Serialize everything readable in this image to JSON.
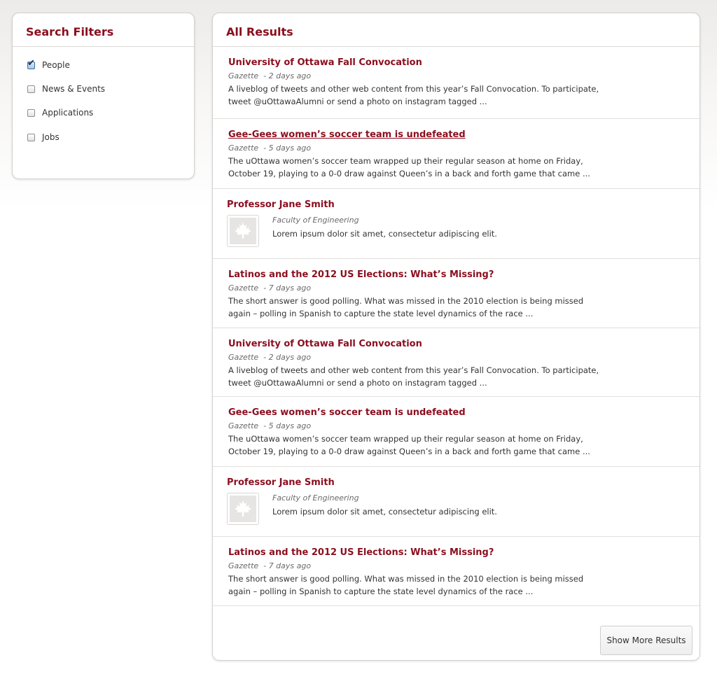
{
  "filters": {
    "title": "Search Filters",
    "items": [
      {
        "label": "People",
        "checked": true
      },
      {
        "label": "News & Events",
        "checked": false
      },
      {
        "label": "Applications",
        "checked": false
      },
      {
        "label": "Jobs",
        "checked": false
      }
    ]
  },
  "results": {
    "title": "All Results",
    "items": [
      {
        "type": "article",
        "title": "University of Ottawa Fall Convocation",
        "source": "Gazette",
        "date": "- 2 days ago",
        "excerpt": "A liveblog of tweets and other web content from this year’s Fall Convocation. To participate, tweet @uOttawaAlumni or send a photo on instagram tagged ..."
      },
      {
        "type": "article",
        "title": "Gee-Gees women’s soccer team is undefeated",
        "source": "Gazette",
        "date": "- 5 days ago",
        "excerpt": "The uOttawa women’s soccer team wrapped up their regular season at home on Friday, October 19, playing to a 0-0 draw against Queen’s in a back and forth game that came ..."
      },
      {
        "type": "person",
        "title": "Professor Jane Smith",
        "department": "Faculty of Engineering",
        "excerpt": "Lorem ipsum dolor sit amet, consectetur adipiscing elit."
      },
      {
        "type": "article",
        "title": "Latinos and the 2012 US Elections: What’s Missing?",
        "source": "Gazette",
        "date": "- 7 days ago",
        "excerpt": "The short answer is good polling. What was missed in the 2010 election is being missed again – polling in Spanish to capture the state level dynamics of the race ..."
      },
      {
        "type": "article",
        "title": "University of Ottawa Fall Convocation",
        "source": "Gazette",
        "date": "- 2 days ago",
        "excerpt": "A liveblog of tweets and other web content from this year’s Fall Convocation. To participate, tweet @uOttawaAlumni or send a photo on instagram tagged ..."
      },
      {
        "type": "article",
        "title": "Gee-Gees women’s soccer team is undefeated",
        "source": "Gazette",
        "date": "- 5 days ago",
        "excerpt": "The uOttawa women’s soccer team wrapped up their regular season at home on Friday, October 19, playing to a 0-0 draw against Queen’s in a back and forth game that came ..."
      },
      {
        "type": "person",
        "title": "Professor Jane Smith",
        "department": "Faculty of Engineering",
        "excerpt": "Lorem ipsum dolor sit amet, consectetur adipiscing elit."
      },
      {
        "type": "article",
        "title": "Latinos and the 2012 US Elections: What’s Missing?",
        "source": "Gazette",
        "date": "- 7 days ago",
        "excerpt": "The short answer is good polling. What was missed in the 2010 election is being missed again – polling in Spanish to capture the state level dynamics of the race ..."
      }
    ],
    "more_label": "Show More Results"
  },
  "colors": {
    "accent": "#8b0e1e",
    "avatar_placeholder": "#e7e5e3"
  },
  "icons": {
    "avatar_placeholder": "maple-leaf-icon",
    "checkbox_checked": "checkmark-icon"
  }
}
